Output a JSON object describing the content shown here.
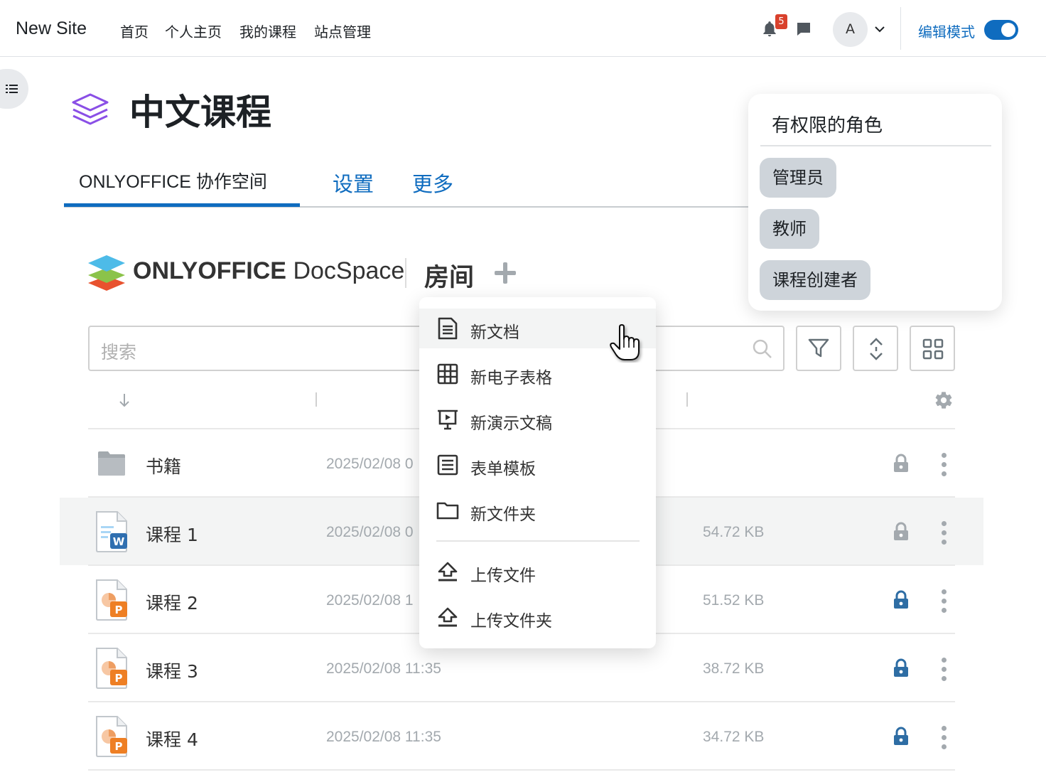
{
  "navbar": {
    "site_name": "New Site",
    "links": [
      "首页",
      "个人主页",
      "我的课程",
      "站点管理"
    ],
    "notification_count": "5",
    "avatar_initial": "A",
    "edit_mode_label": "编辑模式",
    "edit_mode_on": true
  },
  "course": {
    "title": "中文课程"
  },
  "tabs": [
    {
      "label": "ONLYOFFICE 协作空间",
      "active": true
    },
    {
      "label": "设置",
      "active": false
    },
    {
      "label": "更多",
      "active": false
    }
  ],
  "roles": {
    "title": "有权限的角色",
    "items": [
      "管理员",
      "教师",
      "课程创建者"
    ]
  },
  "docspace": {
    "brand_bold": "ONLYOFFICE",
    "brand_light": " DocSpace",
    "section": "房间",
    "search_placeholder": "搜索"
  },
  "files": [
    {
      "name": "书籍",
      "type": "folder",
      "date": "2025/02/08 0",
      "size": "",
      "locked": false
    },
    {
      "name": "课程 1",
      "type": "docx",
      "date": "2025/02/08 0",
      "size": "54.72 KB",
      "locked": false
    },
    {
      "name": "课程 2",
      "type": "pptx",
      "date": "2025/02/08 1",
      "size": "51.52 KB",
      "locked": true
    },
    {
      "name": "课程 3",
      "type": "pptx",
      "date": "2025/02/08 11:35",
      "size": "38.72 KB",
      "locked": true
    },
    {
      "name": "课程 4",
      "type": "pptx",
      "date": "2025/02/08 11:35",
      "size": "34.72 KB",
      "locked": true
    }
  ],
  "context_menu": {
    "items": [
      {
        "label": "新文档",
        "icon": "document-icon"
      },
      {
        "label": "新电子表格",
        "icon": "spreadsheet-icon"
      },
      {
        "label": "新演示文稿",
        "icon": "presentation-icon"
      },
      {
        "label": "表单模板",
        "icon": "form-template-icon"
      },
      {
        "label": "新文件夹",
        "icon": "folder-icon"
      },
      {
        "label": "上传文件",
        "icon": "upload-icon"
      },
      {
        "label": "上传文件夹",
        "icon": "upload-folder-icon"
      }
    ]
  },
  "colors": {
    "accent": "#0f6cbf",
    "lock_active": "#2e6da4",
    "lock_inactive": "#a3a9ae",
    "badge": "#d9412c"
  }
}
